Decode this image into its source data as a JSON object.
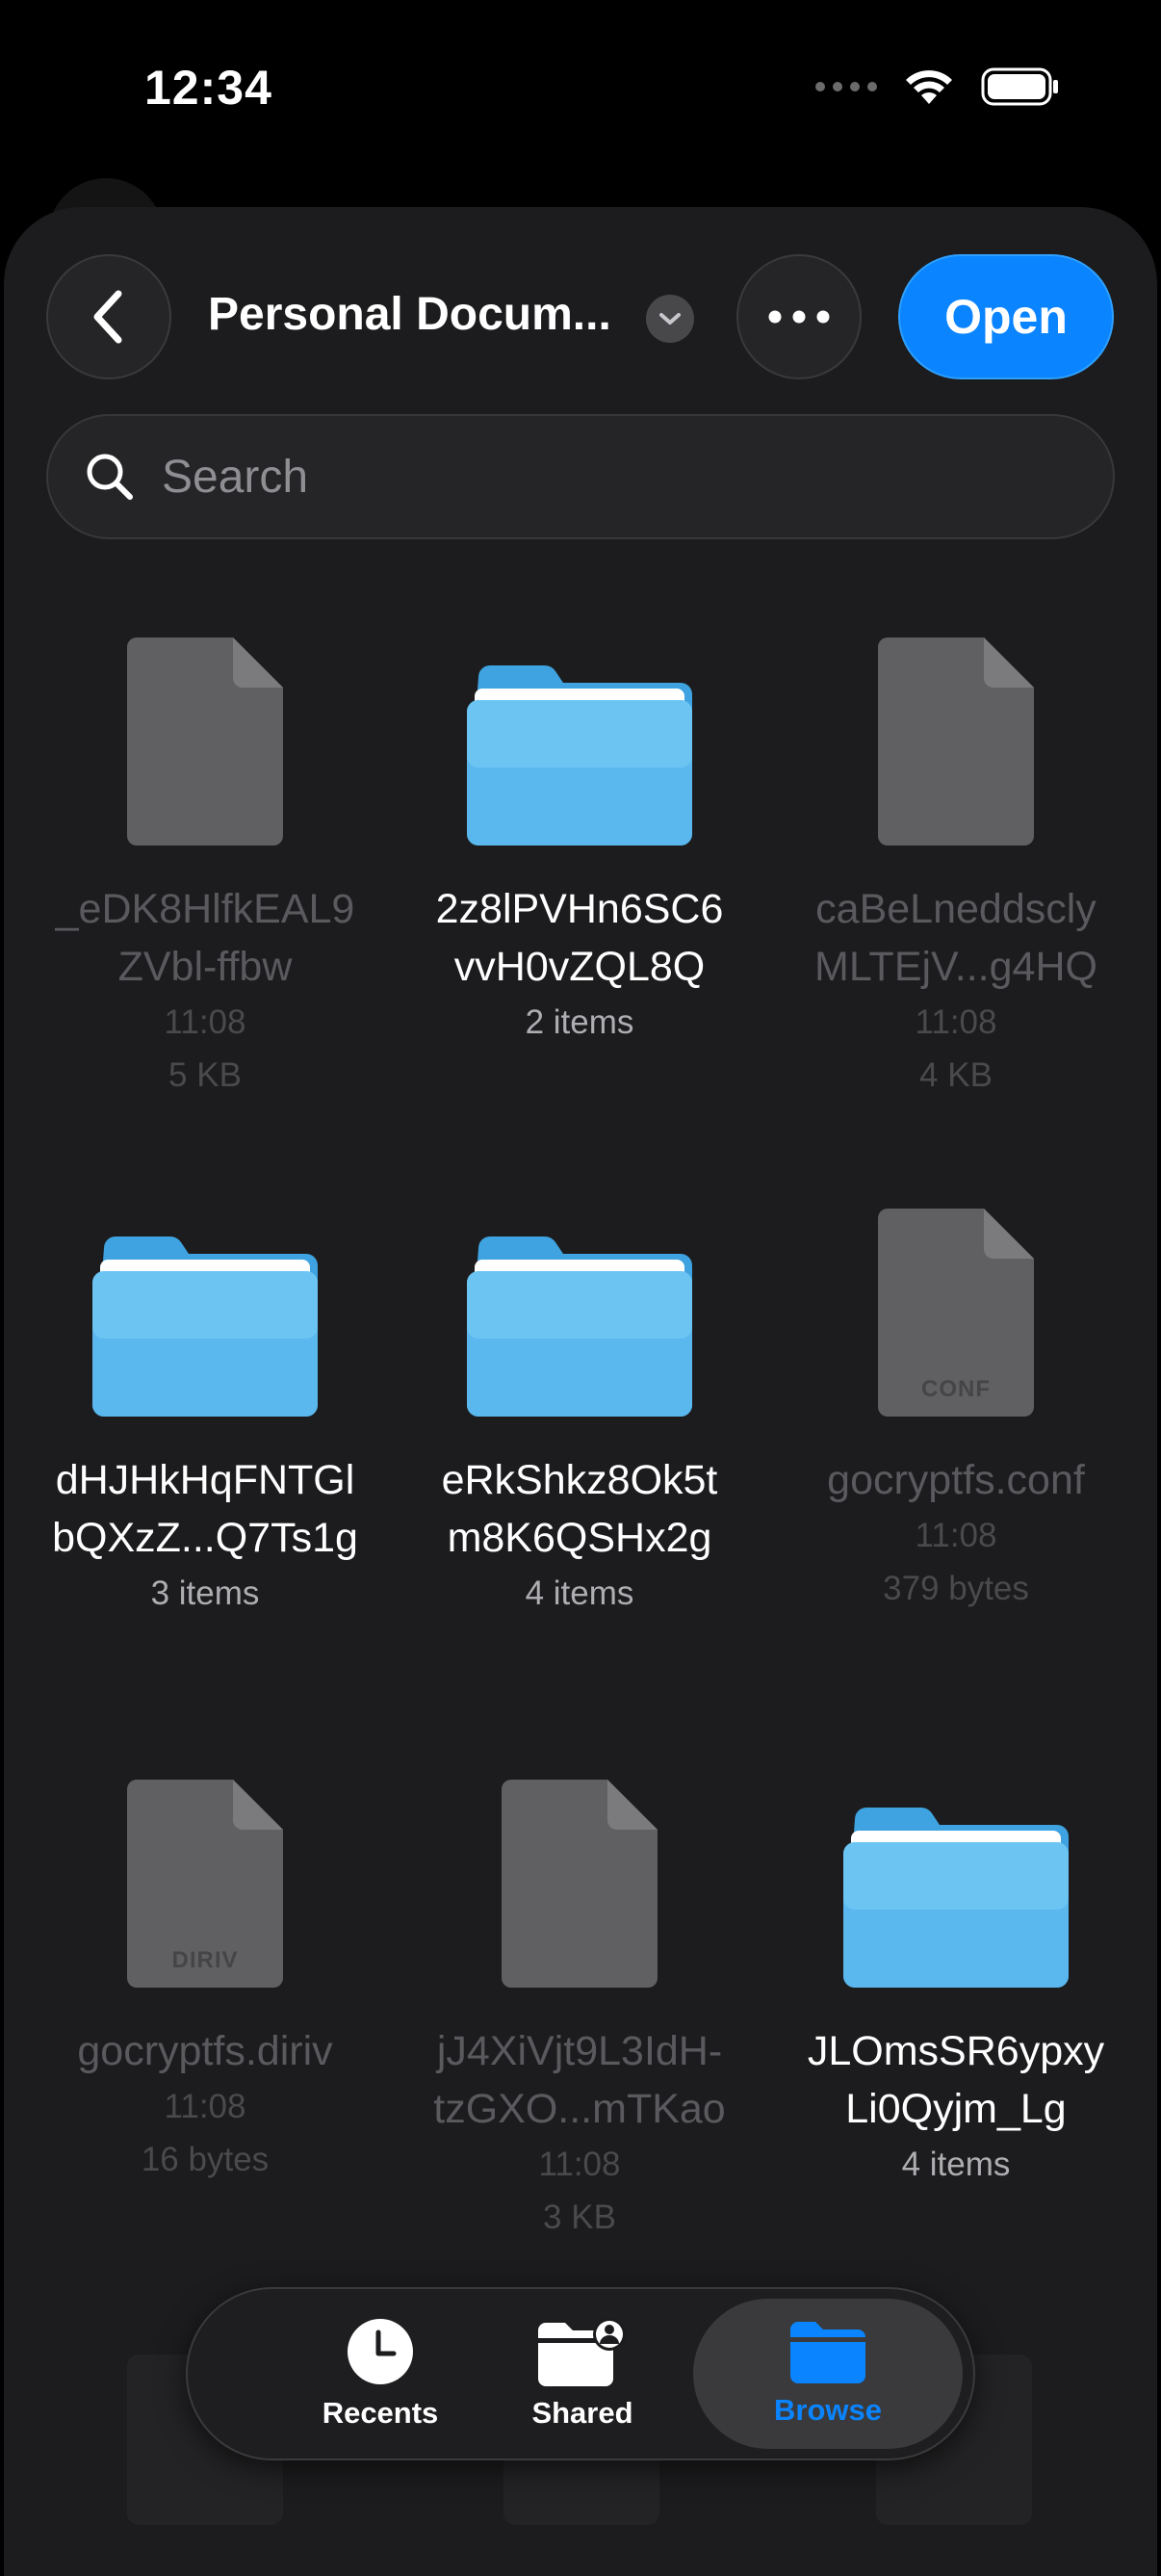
{
  "status_bar": {
    "time": "12:34"
  },
  "header": {
    "title": "Personal Docum...",
    "open_label": "Open"
  },
  "search": {
    "placeholder": "Search"
  },
  "items": [
    {
      "kind": "file",
      "name_line1": "_eDK8HlfkEAL9",
      "name_line2": "ZVbl-ffbw",
      "meta1": "11:08",
      "meta2": "5 KB",
      "ext": ""
    },
    {
      "kind": "folder",
      "name_line1": "2z8lPVHn6SC6",
      "name_line2": "vvH0vZQL8Q",
      "meta1": "2 items",
      "meta2": ""
    },
    {
      "kind": "file",
      "name_line1": "caBeLneddscly",
      "name_line2": "MLTEjV...g4HQ",
      "meta1": "11:08",
      "meta2": "4 KB",
      "ext": ""
    },
    {
      "kind": "folder",
      "name_line1": "dHJHkHqFNTGl",
      "name_line2": "bQXzZ...Q7Ts1g",
      "meta1": "3 items",
      "meta2": ""
    },
    {
      "kind": "folder",
      "name_line1": "eRkShkz8Ok5t",
      "name_line2": "m8K6QSHx2g",
      "meta1": "4 items",
      "meta2": ""
    },
    {
      "kind": "file",
      "name_line1": "gocryptfs.conf",
      "name_line2": "",
      "meta1": "11:08",
      "meta2": "379 bytes",
      "ext": "CONF"
    },
    {
      "kind": "file",
      "name_line1": "gocryptfs.diriv",
      "name_line2": "",
      "meta1": "11:08",
      "meta2": "16 bytes",
      "ext": "DIRIV"
    },
    {
      "kind": "file",
      "name_line1": "jJ4XiVjt9L3IdH-",
      "name_line2": "tzGXO...mTKao",
      "meta1": "11:08",
      "meta2": "3 KB",
      "ext": ""
    },
    {
      "kind": "folder",
      "name_line1": "JLOmsSR6ypxy",
      "name_line2": "Li0Qyjm_Lg",
      "meta1": "4 items",
      "meta2": ""
    }
  ],
  "tabbar": {
    "tabs": [
      {
        "label": "Recents",
        "icon": "clock-icon",
        "active": false
      },
      {
        "label": "Shared",
        "icon": "shared-folder-icon",
        "active": false
      },
      {
        "label": "Browse",
        "icon": "folder-icon",
        "active": true
      }
    ],
    "accent": "#0a84ff"
  },
  "colors": {
    "background": "#1c1c1e",
    "folder": "#5ab8ee",
    "accent": "#0a84ff"
  }
}
